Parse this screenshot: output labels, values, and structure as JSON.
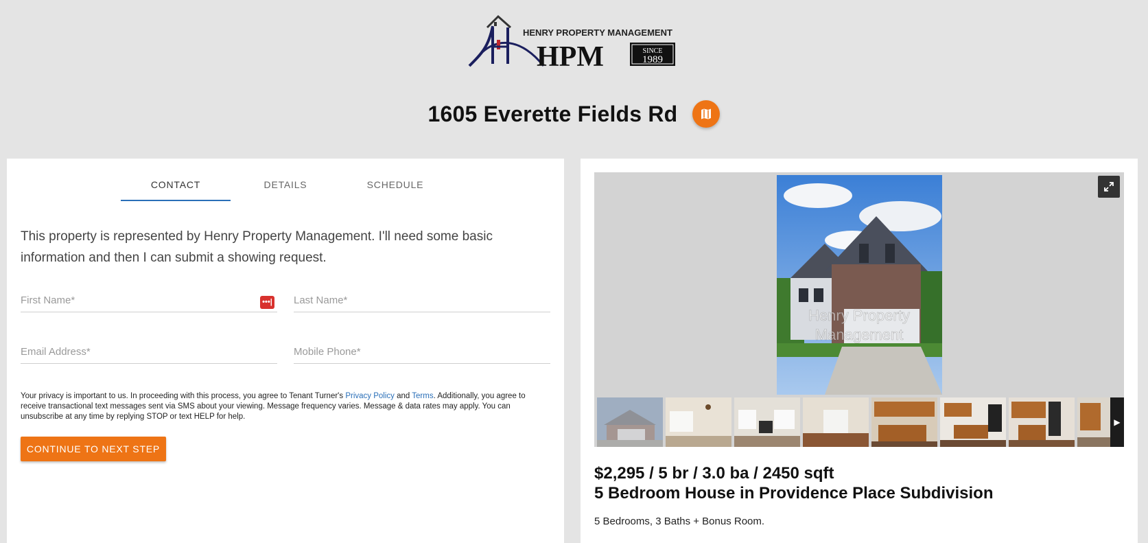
{
  "brand": {
    "company_name": "HENRY PROPERTY MANAGEMENT",
    "abbr": "HPM",
    "since_label": "SINCE",
    "since_year": "1989"
  },
  "property": {
    "address": "1605 Everette Fields Rd"
  },
  "tabs": [
    {
      "label": "CONTACT",
      "active": true
    },
    {
      "label": "DETAILS",
      "active": false
    },
    {
      "label": "SCHEDULE",
      "active": false
    }
  ],
  "form": {
    "intro": "This property is represented by Henry Property Management. I'll need some basic information and then I can submit a showing request.",
    "first_name_placeholder": "First Name*",
    "last_name_placeholder": "Last Name*",
    "email_placeholder": "Email Address*",
    "phone_placeholder": "Mobile Phone*",
    "password_manager_glyph": "•••|",
    "privacy": {
      "part1": "Your privacy is important to us. In proceeding with this process, you agree to Tenant Turner's ",
      "privacy_link": "Privacy Policy",
      "and": " and ",
      "terms_link": "Terms",
      "part2": ". Additionally, you agree to receive transactional text messages sent via SMS about your viewing. Message frequency varies. Message & data rates may apply. You can unsubscribe at any time by replying STOP or text HELP for help."
    },
    "continue_label": "CONTINUE TO NEXT STEP"
  },
  "gallery": {
    "watermark_line1": "Henry Property",
    "watermark_line2": "Management",
    "thumbnails": [
      "exterior-front",
      "living-room-chandelier",
      "family-room-fireplace",
      "dining-room",
      "kitchen-cabinets",
      "kitchen-island",
      "kitchen-appliances",
      "hallway"
    ],
    "next_glyph": "▶"
  },
  "listing": {
    "price_line": "$2,295 / 5 br / 3.0 ba / 2450 sqft",
    "title": "5 Bedroom House in Providence Place Subdivision",
    "description": "5 Bedrooms, 3 Baths + Bonus Room."
  },
  "colors": {
    "accent": "#ee7415",
    "link": "#2a6fb8",
    "logo_navy": "#1b1f5e",
    "background": "#e4e4e4"
  }
}
